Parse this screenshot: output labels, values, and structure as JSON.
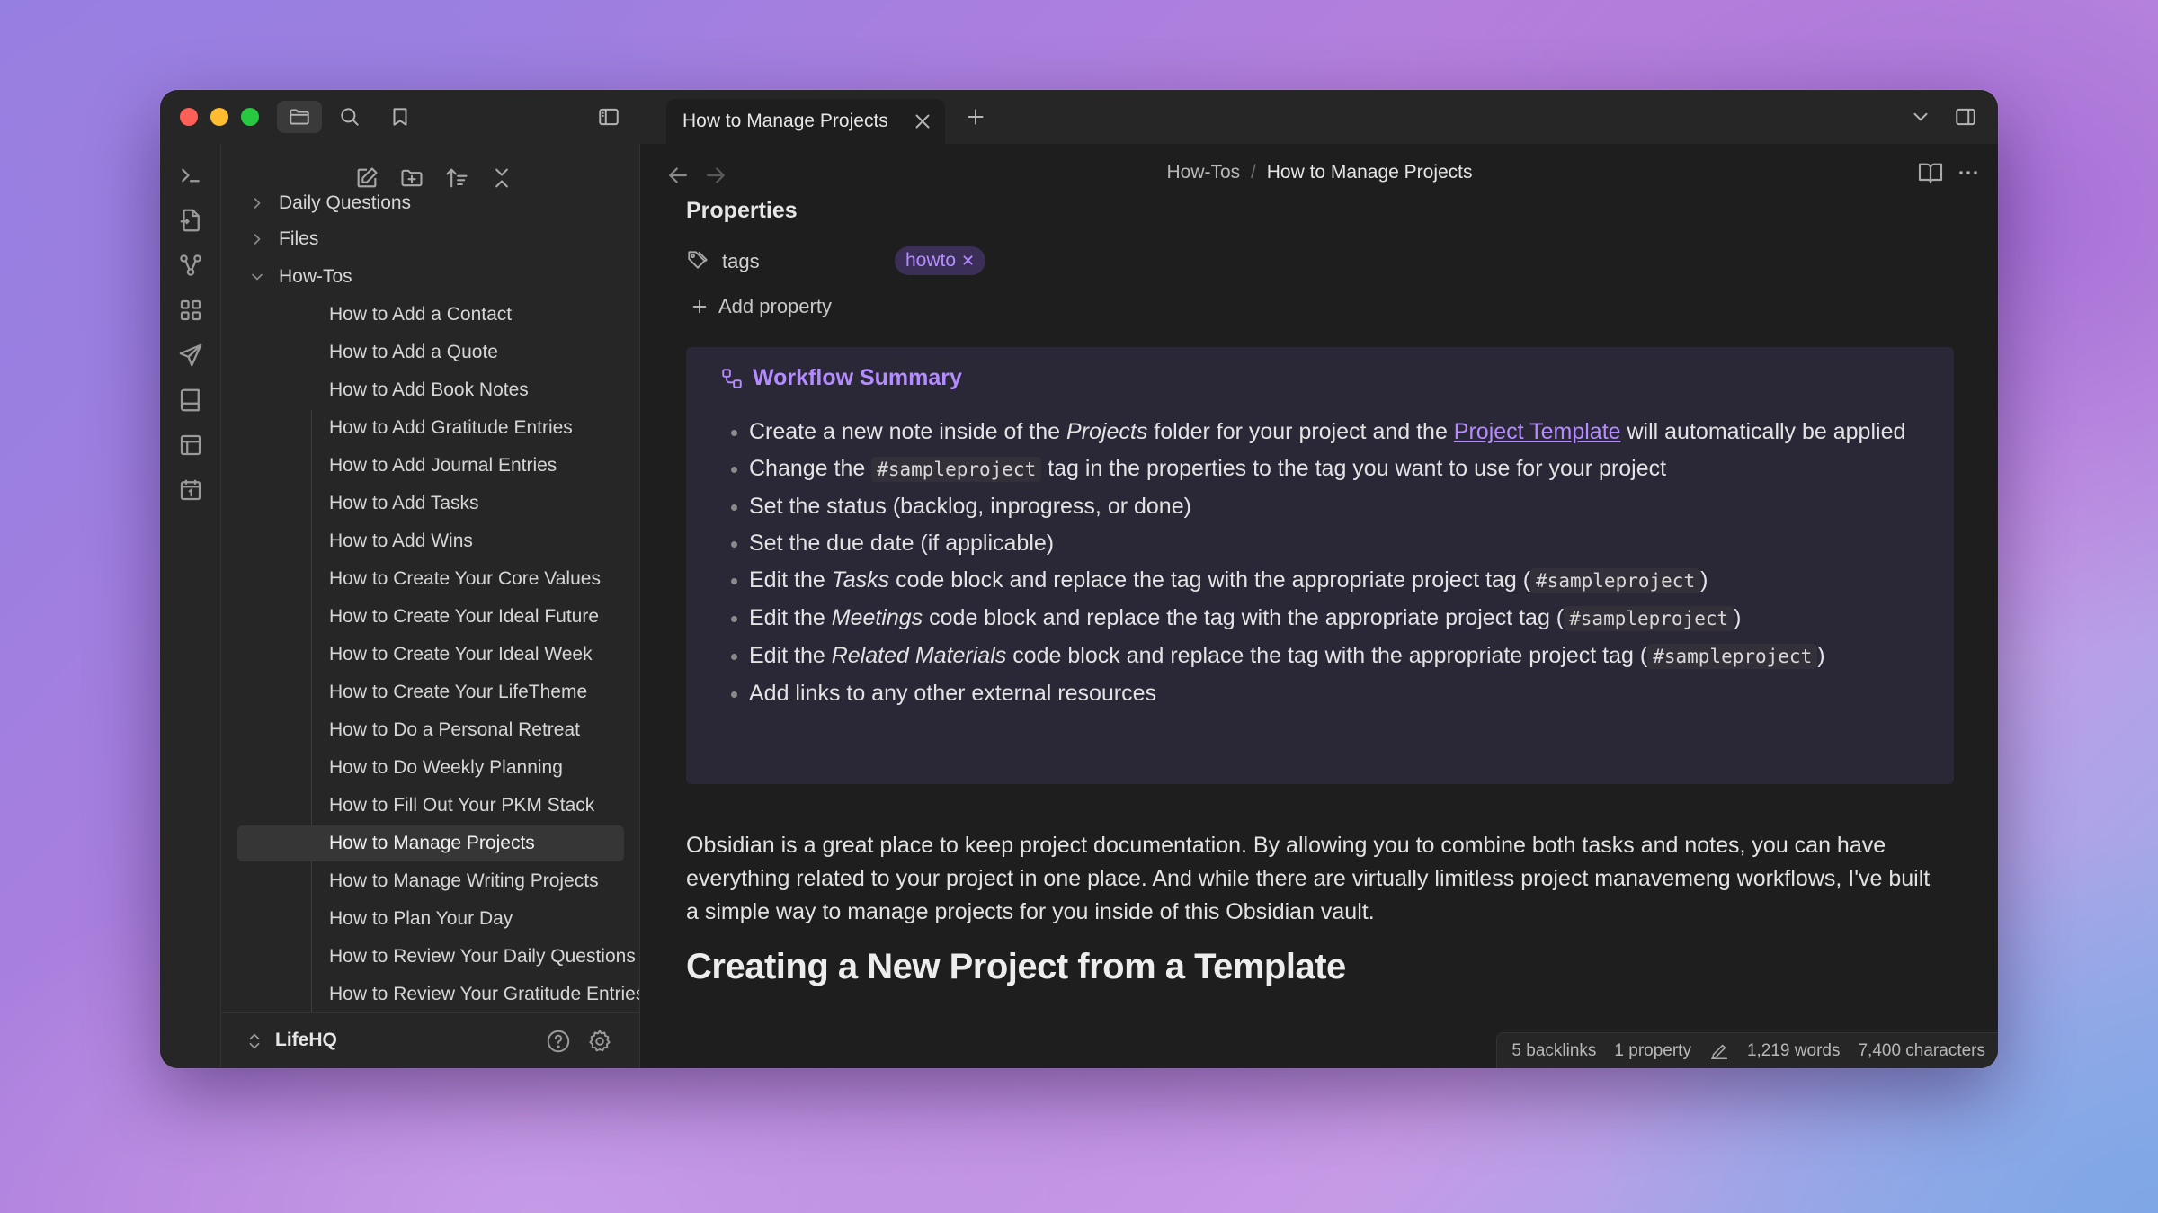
{
  "window": {
    "tab_title": "How to Manage Projects"
  },
  "breadcrumb": {
    "parent": "How-Tos",
    "separator": "/",
    "current": "How to Manage Projects"
  },
  "sidebar": {
    "folders": [
      {
        "label": "Daily Questions"
      },
      {
        "label": "Files"
      },
      {
        "label": "How-Tos"
      }
    ],
    "files": [
      {
        "label": "How to Add a Contact"
      },
      {
        "label": "How to Add a Quote"
      },
      {
        "label": "How to Add Book Notes"
      },
      {
        "label": "How to Add Gratitude Entries"
      },
      {
        "label": "How to Add Journal Entries"
      },
      {
        "label": "How to Add Tasks"
      },
      {
        "label": "How to Add Wins"
      },
      {
        "label": "How to Create Your Core Values"
      },
      {
        "label": "How to Create Your Ideal Future"
      },
      {
        "label": "How to Create Your Ideal Week"
      },
      {
        "label": "How to Create Your LifeTheme"
      },
      {
        "label": "How to Do a Personal Retreat"
      },
      {
        "label": "How to Do Weekly Planning"
      },
      {
        "label": "How to Fill Out Your PKM Stack"
      },
      {
        "label": "How to Manage Projects"
      },
      {
        "label": "How to Manage Writing Projects"
      },
      {
        "label": "How to Plan Your Day"
      },
      {
        "label": "How to Review Your Daily Questions"
      },
      {
        "label": "How to Review Your Gratitude Entries"
      }
    ],
    "active_file": "How to Manage Projects",
    "vault_name": "LifeHQ"
  },
  "properties": {
    "title": "Properties",
    "tags_key": "tags",
    "tag_value": "howto",
    "tag_remove": "✕",
    "add_property": "Add property"
  },
  "callout": {
    "title": "Workflow Summary",
    "items": {
      "i1_a": "Create a new note inside of the ",
      "i1_em": "Projects",
      "i1_b": " folder for your project and the ",
      "i1_link": "Project Template",
      "i1_c": " will automatically be applied",
      "i2_a": "Change the ",
      "i2_code": "#sampleproject",
      "i2_b": " tag in the properties to the tag you want to use for your project",
      "i3": "Set the status (backlog, inprogress, or done)",
      "i4": "Set the due date (if applicable)",
      "i5_a": "Edit the ",
      "i5_em": "Tasks",
      "i5_b": " code block and replace the tag with the appropriate project tag (",
      "i5_code": "#sampleproject",
      "i5_c": ")",
      "i6_a": "Edit the ",
      "i6_em": "Meetings",
      "i6_b": " code block and replace the tag with the appropriate project tag (",
      "i6_code": "#sampleproject",
      "i6_c": ")",
      "i7_a": "Edit the ",
      "i7_em": "Related Materials",
      "i7_b": " code block and replace the tag with the appropriate project tag (",
      "i7_code": "#sampleproject",
      "i7_c": ")",
      "i8": "Add links to any other external resources"
    }
  },
  "body": {
    "paragraph": "Obsidian is a great place to keep project documentation. By allowing you to combine both tasks and notes, you can have everything related to your project in one place. And while there are virtually limitless project manavemeng workflows, I've built a simple way to manage projects for you inside of this Obsidian vault.",
    "heading": "Creating a New Project from a Template"
  },
  "status": {
    "backlinks": "5 backlinks",
    "properties": "1 property",
    "words": "1,219 words",
    "characters": "7,400 characters"
  },
  "colors": {
    "accent": "#b58cff",
    "background": "#1e1e1e",
    "panel": "#262626",
    "callout_bg": "#2a2736"
  }
}
